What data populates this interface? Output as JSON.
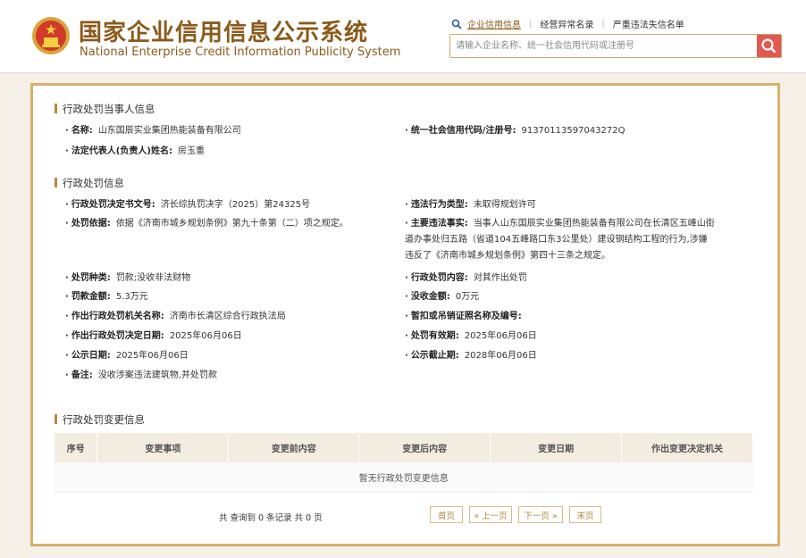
{
  "header": {
    "title_cn": "国家企业信用信息公示系统",
    "title_en": "National Enterprise Credit Information Publicity System",
    "links": [
      "企业信用信息",
      "经营异常名录",
      "严重违法失信名单"
    ],
    "search_placeholder": "请输入企业名称、统一社会信用代码或注册号",
    "colors": {
      "brand": "#8b5a1a",
      "search_button": "#e25852",
      "frame": "#d6b16d"
    }
  },
  "party_section": {
    "title": "行政处罚当事人信息",
    "name_label": "名称:",
    "name_value": "山东国辰实业集团热能装备有限公司",
    "code_label": "统一社会信用代码/注册号:",
    "code_value": "91370113597043272Q",
    "rep_label": "法定代表人(负责人)姓名:",
    "rep_value": "房玉重"
  },
  "penalty_section": {
    "title": "行政处罚信息",
    "doc_label": "行政处罚决定书文号:",
    "doc_value": "济长综执罚决字（2025）第24325号",
    "type_label": "违法行为类型:",
    "type_value": "未取得规划许可",
    "basis_label": "处罚依据:",
    "basis_value": "依据《济南市城乡规划条例》第九十条第（二）项之规定。",
    "facts_label": "主要违法事实:",
    "facts_value": "当事人山东国辰实业集团热能装备有限公司在长清区五峰山街道办事处归五路（省道104五峰路口东3公里处）建设钢结构工程的行为,涉嫌违反了《济南市城乡规划条例》第四十三条之规定。",
    "kind_label": "处罚种类:",
    "kind_value": "罚款;没收非法财物",
    "content_label": "行政处罚内容:",
    "content_value": "对其作出处罚",
    "fine_label": "罚款金额:",
    "fine_value": "5.3万元",
    "confiscate_label": "没收金额:",
    "confiscate_value": "0万元",
    "org_label": "作出行政处罚机关名称:",
    "org_value": "济南市长清区综合行政执法局",
    "license_label": "暂扣或吊销证照名称及编号:",
    "license_value": "",
    "date_label": "作出行政处罚决定日期:",
    "date_value": "2025年06月06日",
    "valid_label": "处罚有效期:",
    "valid_value": "2025年06月06日",
    "pub_label": "公示日期:",
    "pub_value": "2025年06月06日",
    "pubend_label": "公示截止期:",
    "pubend_value": "2028年06月06日",
    "note_label": "备注:",
    "note_value": "没收涉案违法建筑物,并处罚款"
  },
  "change_section": {
    "title": "行政处罚变更信息",
    "columns": [
      "序号",
      "变更事项",
      "变更前内容",
      "变更后内容",
      "变更日期",
      "作出变更决定机关"
    ],
    "empty_text": "暂无行政处罚变更信息"
  },
  "pager": {
    "summary": "共 查询到 0 条记录 共 0 页",
    "first": "首页",
    "prev": "« 上一页",
    "next": "下一页 »",
    "last": "末页"
  }
}
